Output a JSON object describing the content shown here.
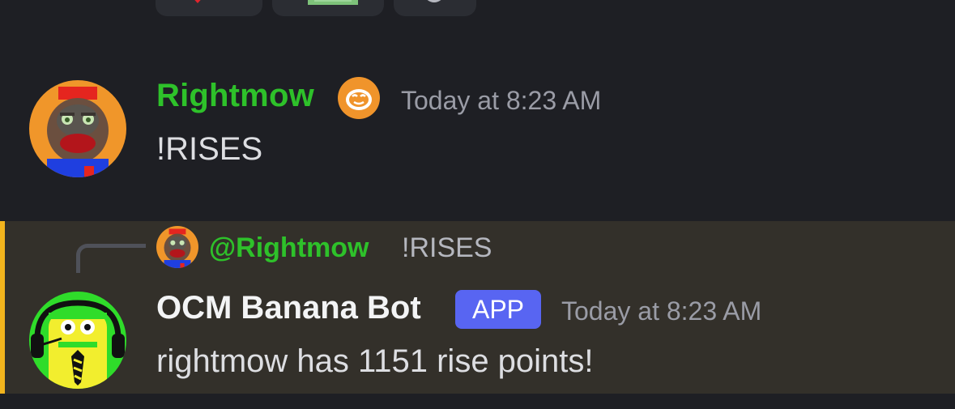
{
  "reactions": [
    {
      "icon": "red-heart-emoji-icon"
    },
    {
      "icon": "money-emoji-icon"
    },
    {
      "icon": "add-reaction-icon"
    }
  ],
  "message1": {
    "avatar": "monkey-avatar-icon",
    "username": "Rightmow",
    "username_color": "#2ec12a",
    "role_icon": "orange-monkey-role-icon",
    "timestamp": "Today at 8:23 AM",
    "text": "!RISES"
  },
  "message2": {
    "reply": {
      "avatar": "monkey-avatar-icon",
      "mention": "@Rightmow",
      "text": "!RISES"
    },
    "avatar": "banana-bot-avatar-icon",
    "username": "OCM Banana Bot",
    "badge": "APP",
    "badge_color": "#5865f2",
    "timestamp": "Today at 8:23 AM",
    "text": "rightmow has 1151 rise points!",
    "highlight_color": "#f2b41d"
  }
}
